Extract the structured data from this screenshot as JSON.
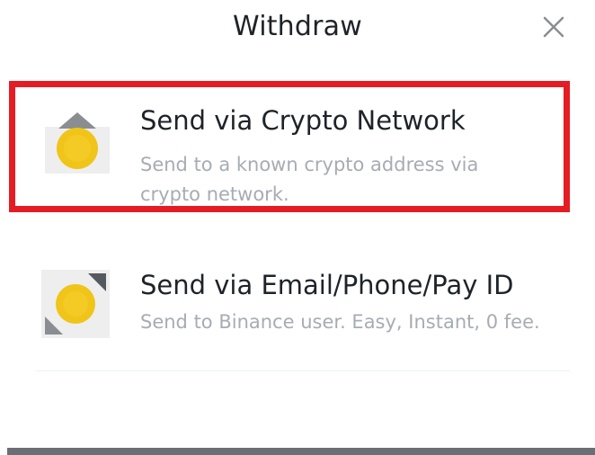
{
  "header": {
    "title": "Withdraw",
    "close_icon": "close-icon"
  },
  "options": [
    {
      "label": "Send via Crypto Network",
      "description": "Send to a known crypto address via crypto network.",
      "icon": "crypto-network-icon",
      "highlighted": true,
      "highlight_color": "#e51c23"
    },
    {
      "label": "Send via Email/Phone/Pay ID",
      "description": "Send to Binance user. Easy, Instant, 0 fee.",
      "icon": "email-phone-pay-id-icon",
      "highlighted": false
    }
  ],
  "colors": {
    "accent_yellow": "#f0c419",
    "icon_gray": "#8a8d92",
    "text_primary": "#1e2329",
    "text_secondary": "#a7acb3"
  }
}
